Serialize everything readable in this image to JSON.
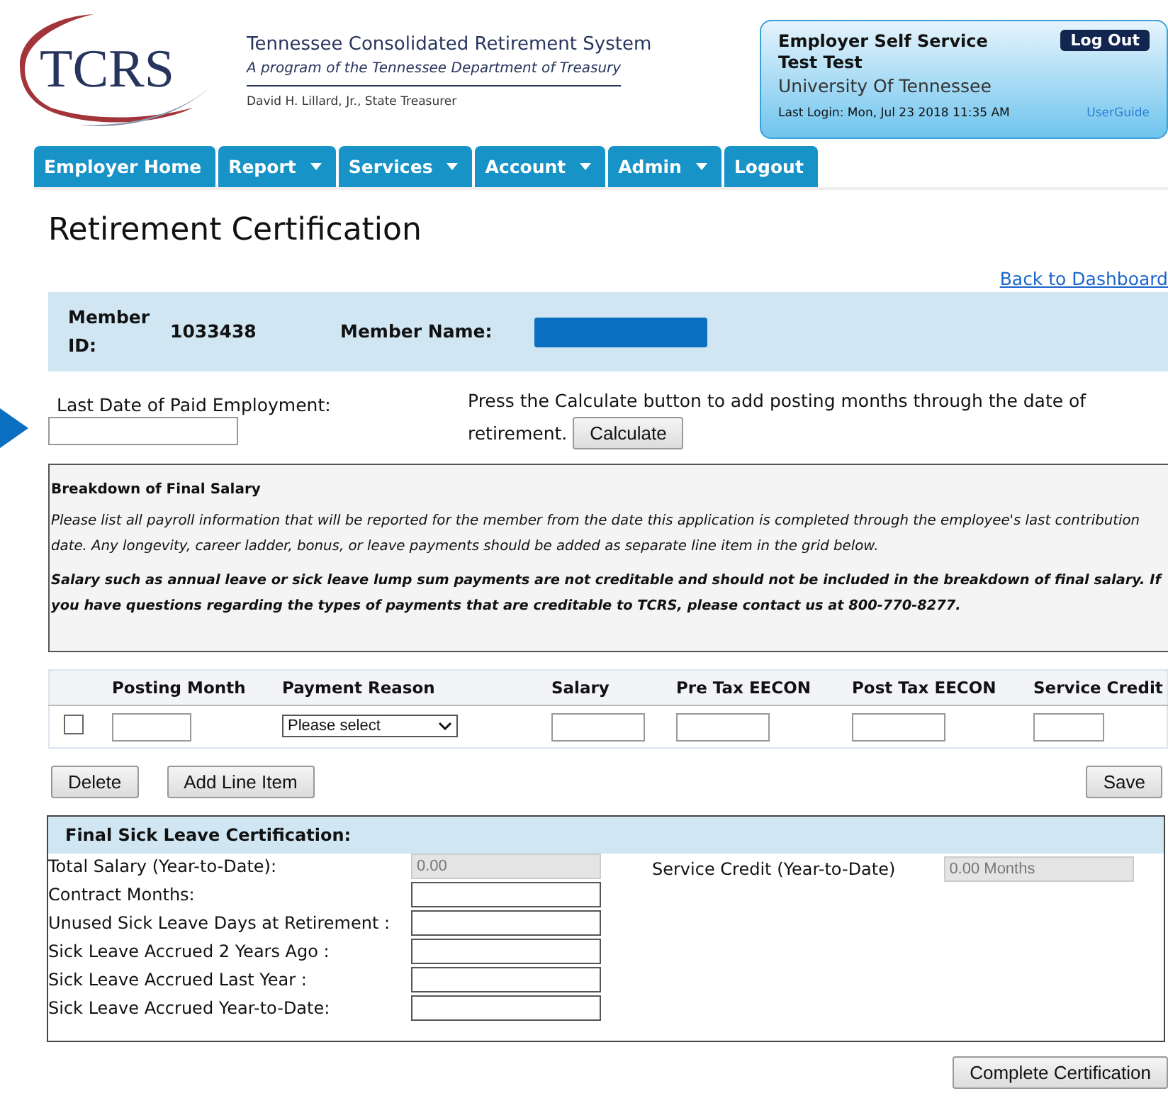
{
  "header": {
    "logo_text": "TCRS",
    "org_name": "Tennessee Consolidated Retirement System",
    "org_subtitle": "A program of the Tennessee Department of Treasury",
    "treasurer": "David H. Lillard, Jr., State Treasurer"
  },
  "account_panel": {
    "title": "Employer Self Service",
    "logout": "Log Out",
    "user": "Test Test",
    "organization": "University Of Tennessee",
    "last_login": "Last Login: Mon, Jul 23 2018 11:35 AM",
    "guide_link": "UserGuide"
  },
  "nav": [
    {
      "label": "Employer Home",
      "dropdown": false
    },
    {
      "label": "Report",
      "dropdown": true
    },
    {
      "label": "Services",
      "dropdown": true
    },
    {
      "label": "Account",
      "dropdown": true
    },
    {
      "label": "Admin",
      "dropdown": true
    },
    {
      "label": "Logout",
      "dropdown": false
    }
  ],
  "page_title": "Retirement Certification",
  "back_link": "Back to Dashboard",
  "member": {
    "id_label": "Member ID:",
    "id_value": "1033438",
    "name_label": "Member Name:",
    "name_redacted": true
  },
  "last_date": {
    "label": "Last Date of Paid Employment:",
    "instruction_lines": [
      "Press the Calculate button to add posting months through the date of",
      "retirement."
    ],
    "button": "Calculate"
  },
  "breakdown": {
    "title": "Breakdown of Final Salary",
    "paragraph": "Please list all payroll information that will be reported for the member from the date this application is completed through the employee's last contribution date. Any longevity, career ladder, bonus, or leave payments should be added as separate line item in the grid below.",
    "warning": "Salary such as annual leave or sick leave lump sum payments are not creditable and should not be included in the breakdown of final salary. If you have questions regarding the types of payments that are creditable to TCRS, please contact us at 800-770-8277."
  },
  "grid": {
    "columns": [
      "Posting Month",
      "Payment Reason",
      "Salary",
      "Pre Tax EECON",
      "Post Tax EECON",
      "Service Credit"
    ],
    "rows": [
      {
        "checked": false,
        "payment_reason": "Please select"
      }
    ]
  },
  "grid_buttons": {
    "delete": "Delete",
    "add": "Add Line Item",
    "save": "Save"
  },
  "sick_leave": {
    "title": "Final Sick Leave Certification:",
    "fields": [
      {
        "label": "Total Salary (Year-to-Date):",
        "kind": "readonly",
        "value": "0.00"
      },
      {
        "label": "Contract Months:",
        "kind": "input"
      },
      {
        "label": "Unused Sick Leave Days at Retirement :",
        "kind": "input"
      },
      {
        "label": "Sick Leave Accrued 2 Years Ago :",
        "kind": "input"
      },
      {
        "label": "Sick Leave Accrued Last Year :",
        "kind": "input"
      },
      {
        "label": "Sick Leave Accrued Year-to-Date:",
        "kind": "input"
      }
    ],
    "side_field": {
      "label": "Service Credit (Year-to-Date)",
      "kind": "readonly",
      "value": "0.00 Months"
    }
  },
  "complete_button": "Complete Certification"
}
